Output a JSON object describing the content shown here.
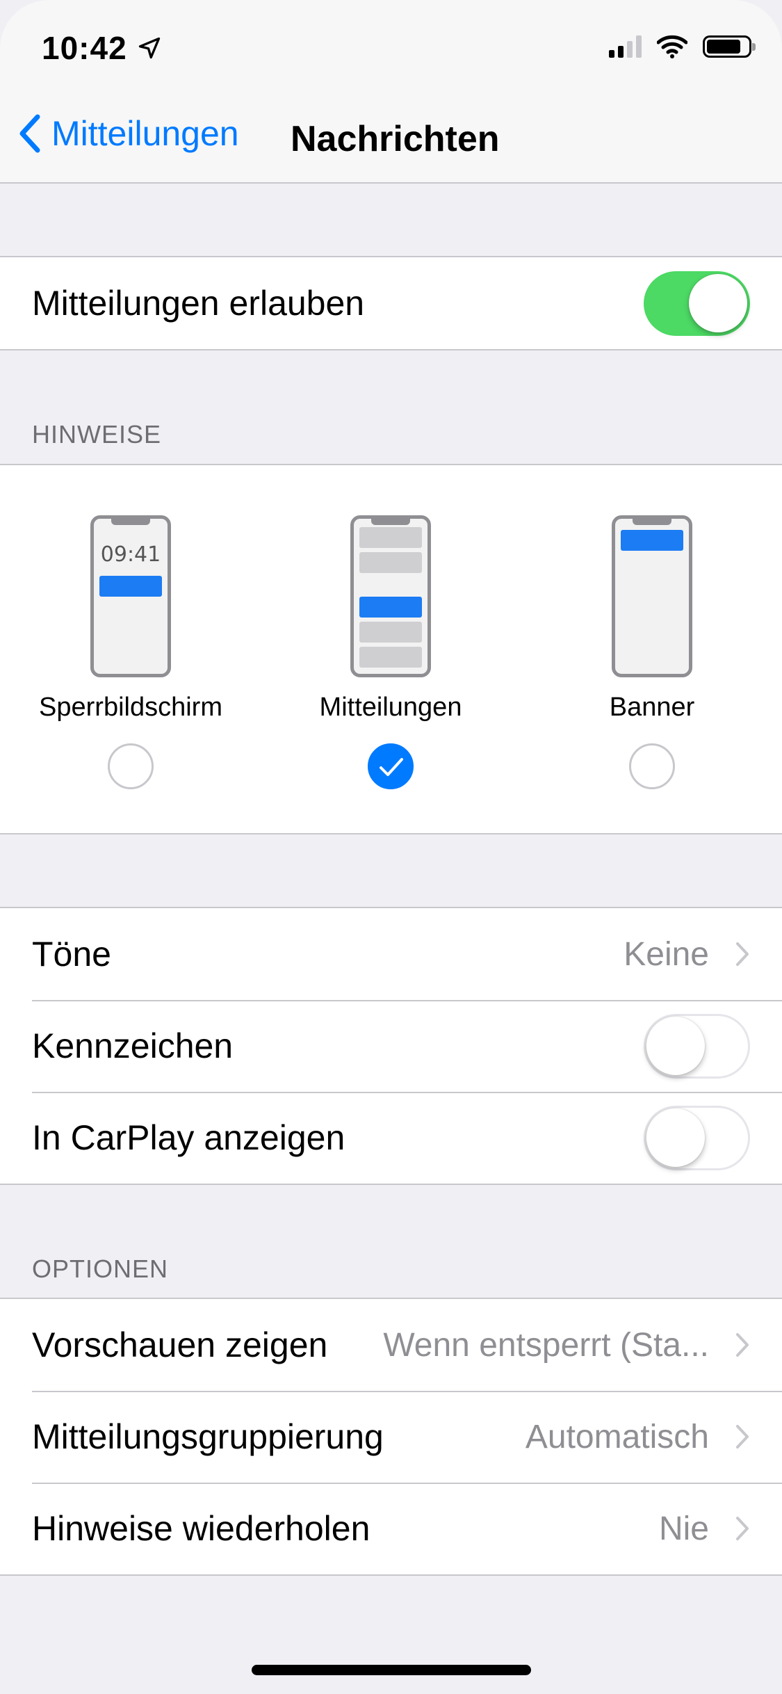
{
  "status_bar": {
    "time": "10:42",
    "location_icon": "location-arrow-icon",
    "signal_icon": "cellular-signal-icon",
    "wifi_icon": "wifi-icon",
    "battery_icon": "battery-icon",
    "signal_bars_filled": 2,
    "signal_bars_total": 4
  },
  "nav": {
    "back_label": "Mitteilungen",
    "back_icon": "chevron-left-icon",
    "title": "Nachrichten"
  },
  "allow_notifications": {
    "label": "Mitteilungen erlauben",
    "enabled": true
  },
  "alerts": {
    "header": "HINWEISE",
    "options": [
      {
        "label": "Sperrbildschirm",
        "preview_time": "09:41",
        "selected": false
      },
      {
        "label": "Mitteilungen",
        "selected": true
      },
      {
        "label": "Banner",
        "selected": false
      }
    ]
  },
  "settings": [
    {
      "label": "Töne",
      "value": "Keine",
      "type": "disclosure"
    },
    {
      "label": "Kennzeichen",
      "enabled": false,
      "type": "switch"
    },
    {
      "label": "In CarPlay anzeigen",
      "enabled": false,
      "type": "switch"
    }
  ],
  "options": {
    "header": "OPTIONEN",
    "items": [
      {
        "label": "Vorschauen zeigen",
        "value": "Wenn entsperrt (Sta..."
      },
      {
        "label": "Mitteilungsgruppierung",
        "value": "Automatisch"
      },
      {
        "label": "Hinweise wiederholen",
        "value": "Nie"
      }
    ]
  },
  "colors": {
    "accent": "#007aff",
    "switch_on": "#4cd964",
    "background": "#efeff4",
    "separator": "#c8c7cc",
    "secondary_text": "#8e8e93"
  }
}
